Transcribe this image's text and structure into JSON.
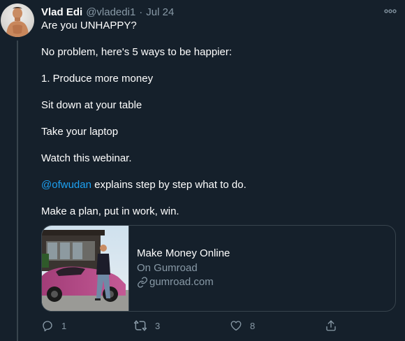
{
  "author": {
    "display_name": "Vlad Edi",
    "handle": "@vladedi1",
    "separator": "·",
    "date": "Jul 24"
  },
  "tweet": {
    "lines": [
      "Are you UNHAPPY?",
      "No problem, here's 5 ways to be happier:",
      "1. Produce more money",
      "Sit down at your table",
      "Take your laptop",
      "Watch this webinar.",
      "explains step by step what to do.",
      "Make a plan, put in work, win."
    ],
    "mention": "@ofwudan"
  },
  "card": {
    "title": "Make Money Online",
    "description": "On Gumroad",
    "domain": "gumroad.com"
  },
  "actions": {
    "reply_count": "1",
    "retweet_count": "3",
    "like_count": "8"
  },
  "icons": {
    "more": "more-horizontal-icon",
    "reply": "reply-icon",
    "retweet": "retweet-icon",
    "like": "like-icon",
    "share": "share-icon",
    "link": "link-icon"
  },
  "colors": {
    "background": "#15202b",
    "accent": "#1da1f2",
    "secondary_text": "#8899a6",
    "border": "#38444d"
  }
}
